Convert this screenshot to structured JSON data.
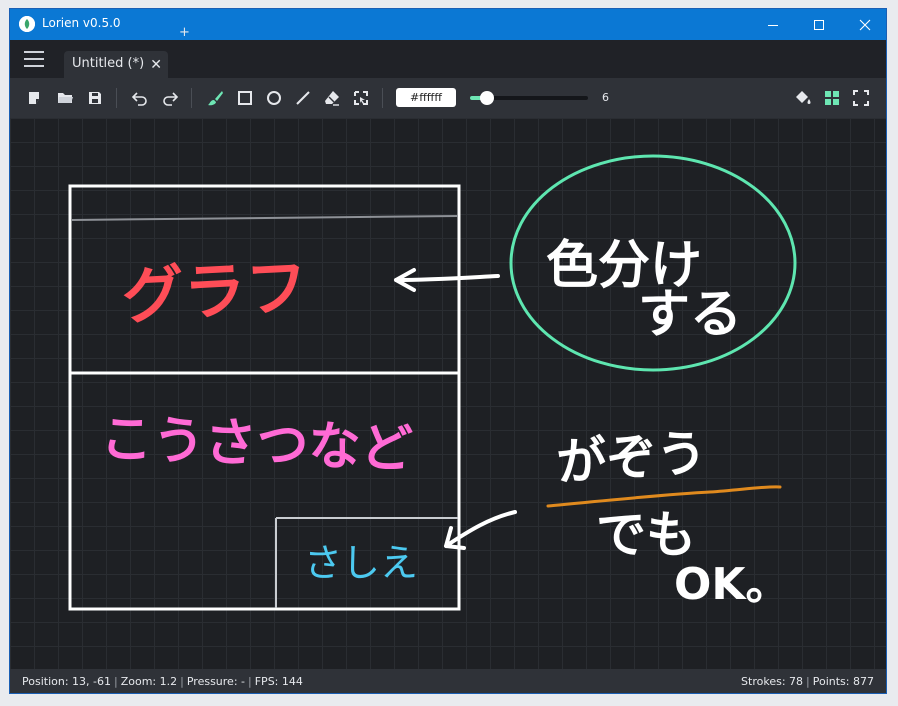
{
  "window": {
    "title": "Lorien v0.5.0",
    "controls": {
      "minimize": "minimize-icon",
      "maximize": "maximize-icon",
      "close": "close-icon"
    }
  },
  "tabbar": {
    "menu_icon": "hamburger-menu-icon",
    "tabs": [
      {
        "label": "Untitled (*)",
        "close": "✕"
      }
    ],
    "add_tab": "+"
  },
  "toolbar": {
    "file_tools": [
      "new-file-icon",
      "open-folder-icon",
      "save-icon"
    ],
    "history_tools": [
      "undo-icon",
      "redo-icon"
    ],
    "draw_tools": [
      "brush-icon",
      "rectangle-icon",
      "circle-icon",
      "line-icon",
      "eraser-icon",
      "selection-icon"
    ],
    "active_tool": "brush-icon",
    "color_value": "#ffffff",
    "brush_size": "6",
    "brush_size_slider_fraction": 0.14,
    "right_tools": [
      "background-color-icon",
      "grid-icon",
      "fullscreen-icon"
    ],
    "accent_color": "#6ee6b4"
  },
  "canvas": {
    "background": "#1e2024",
    "texts": {
      "graph": "グラフ",
      "intersection": "こうさつなど",
      "illustration": "さしえ",
      "color_coding_1": "色分け",
      "color_coding_2": "する",
      "image_1": "がぞう",
      "image_2": "でも",
      "image_3": "OK。"
    },
    "colors": {
      "white": "#ffffff",
      "red": "#ff4d57",
      "pink": "#ff6ad5",
      "cyan": "#4cc9f0",
      "green": "#5ee6b0",
      "orange": "#e08a1e",
      "gray": "#8e9197"
    }
  },
  "status": {
    "position": "Position: 13, -61",
    "zoom": "Zoom: 1.2",
    "pressure": "Pressure: -",
    "fps": "FPS: 144",
    "strokes": "Strokes: 78",
    "points": "Points: 877"
  }
}
